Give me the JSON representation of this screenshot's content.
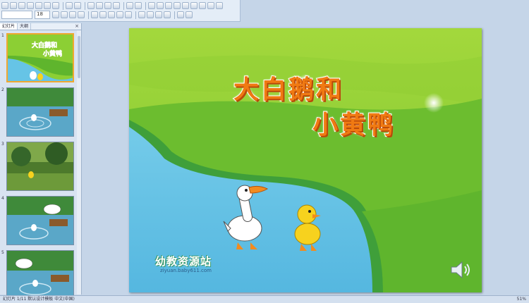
{
  "toolbar": {
    "font_size": "18",
    "row1_icons": [
      "new-icon",
      "open-icon",
      "save-icon",
      "permission-icon",
      "email-icon",
      "print-icon",
      "print-preview-icon",
      "spelling-icon",
      "research-icon",
      "cut-icon",
      "copy-icon",
      "paste-icon",
      "format-painter-icon",
      "undo-icon",
      "redo-icon",
      "hyperlink-icon",
      "table-icon",
      "chart-icon",
      "new-slide-icon",
      "expand-icon",
      "grid-icon",
      "color-icon",
      "zoom-icon",
      "help-icon"
    ],
    "row2_icons": [
      "bold-icon",
      "italic-icon",
      "underline-icon",
      "shadow-icon",
      "align-left-icon",
      "center-icon",
      "align-right-icon",
      "numbering-icon",
      "bullets-icon",
      "increase-font-icon",
      "decrease-font-icon",
      "indent-icon",
      "font-color-icon",
      "design-icon",
      "new-slide2-icon"
    ]
  },
  "left_pane": {
    "tabs": [
      "幻灯片",
      "大纲"
    ],
    "close": "×",
    "thumbnails": [
      {
        "number": "1"
      },
      {
        "number": "2"
      },
      {
        "number": "3"
      },
      {
        "number": "4"
      },
      {
        "number": "5"
      }
    ]
  },
  "slide": {
    "title_line1": "大白鹅和",
    "title_line2": "小黄鸭",
    "logo_text": "幼教资源站",
    "logo_url": "ziyuan.baby611.com",
    "colors": {
      "sky_green": "#8ccf34",
      "field_green": "#5fb52d",
      "water": "#66c4e6",
      "title_orange": "#f07a12"
    }
  },
  "status_bar": {
    "left": "幻灯片 1/11   默认设计模板   中文(中国)",
    "right": "51%"
  }
}
